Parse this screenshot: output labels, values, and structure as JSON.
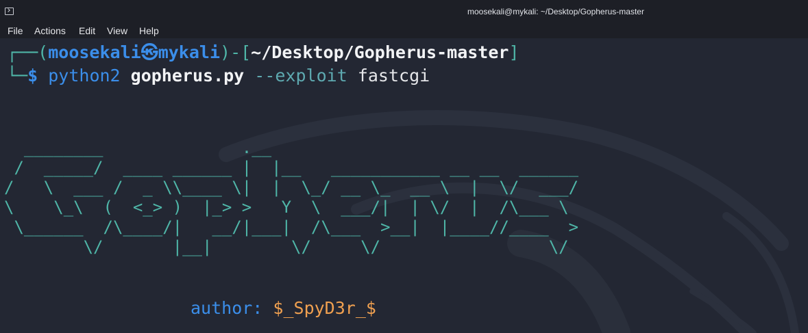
{
  "window": {
    "title": "moosekali@mykali: ~/Desktop/Gopherus-master"
  },
  "menu": {
    "items": [
      "File",
      "Actions",
      "Edit",
      "View",
      "Help"
    ]
  },
  "prompt": {
    "line1_prefix": "┌──(",
    "user": "moosekali",
    "at_symbol": "㉿",
    "host": "mykali",
    "mid": ")-[",
    "path": "~/Desktop/Gopherus-master",
    "suffix": "]",
    "line2_prefix": "└─",
    "dollar": "$"
  },
  "command": {
    "program": "python2",
    "script": "gopherus.py",
    "option": "--exploit",
    "value": "fastcgi"
  },
  "banner": {
    "ascii": "  ________              .__\n /  _____/  ____ ______ |  |__   ___________ __ __  ______\n/   \\  ___ /  _ \\\\____ \\|  |  \\_/ __ \\_  __ \\  |  \\/  ___/\n\\    \\_\\  (  <_> )  |_> >   Y  \\  ___/|  | \\/  |  /\\___ \\\n \\______  /\\____/|   __/|___|  /\\___  >__|  |____//____  >\n        \\/       |__|        \\/     \\/                 \\/",
    "author_label": "author:",
    "author_value": "$_SpyD3r_$"
  },
  "colors": {
    "background": "#232733",
    "titlebar": "#1d1f26",
    "teal": "#4fb6a8",
    "blue": "#3b8eea",
    "orange": "#f0a050"
  }
}
